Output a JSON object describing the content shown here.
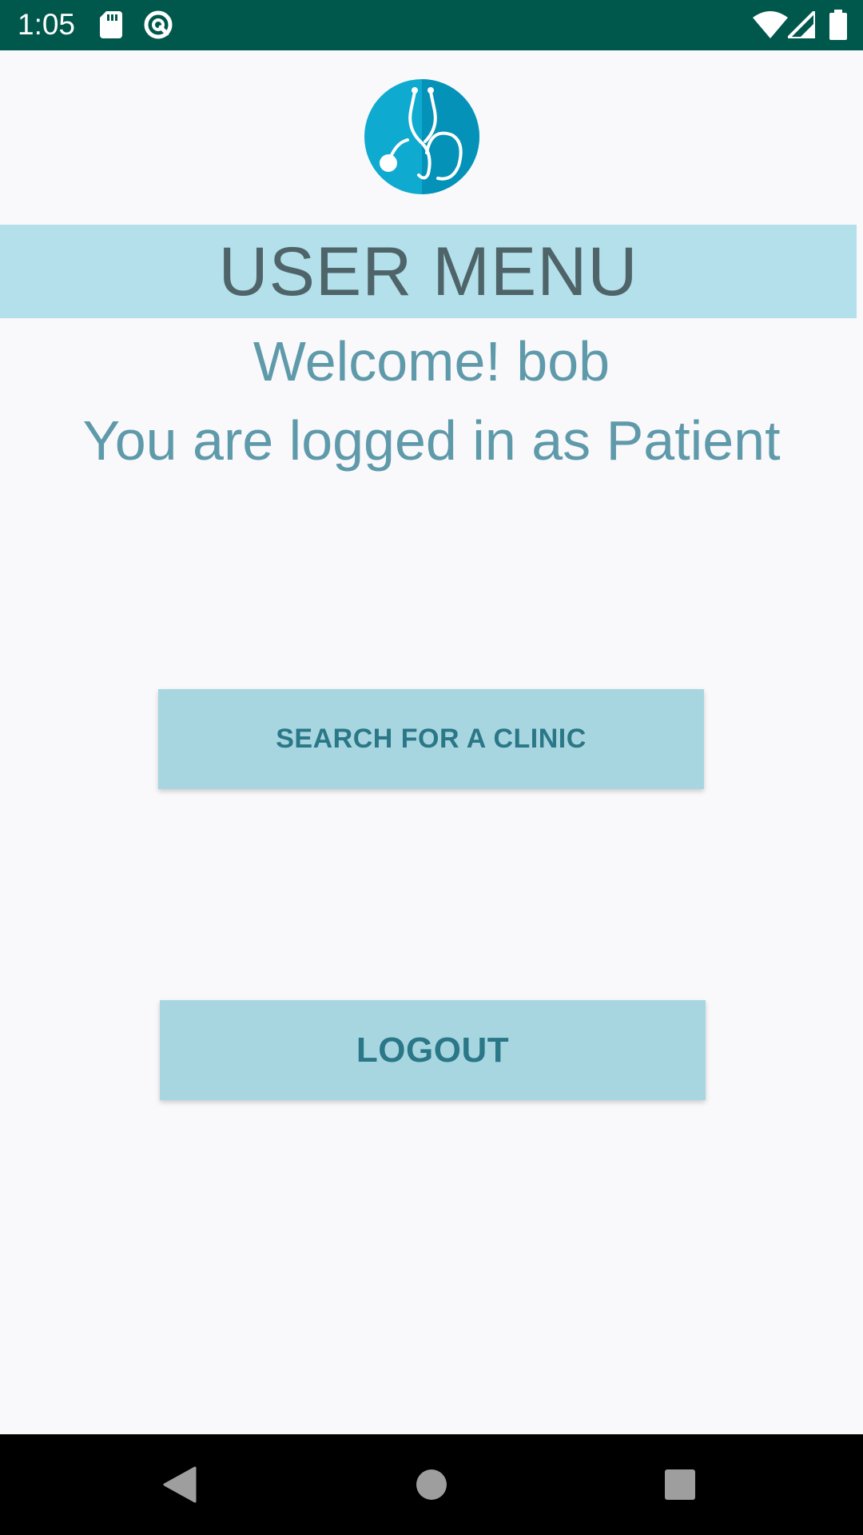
{
  "status_bar": {
    "time": "1:05",
    "background_color": "#00584d",
    "icons": [
      "sd-card-icon",
      "ring-icon",
      "wifi-icon",
      "signal-icon",
      "battery-icon"
    ]
  },
  "logo": {
    "icon": "stethoscope-icon",
    "color": "#0b9cc6"
  },
  "header": {
    "title": "USER MENU",
    "background_color": "#b3e0eb"
  },
  "welcome": {
    "greeting": "Welcome! bob",
    "role_line": "You are logged in as Patient"
  },
  "buttons": {
    "search_label": "SEARCH FOR A CLINIC",
    "logout_label": "LOGOUT",
    "background_color": "#a8d6e0",
    "text_color": "#2a7788"
  },
  "nav_bar": {
    "icons": [
      "back-icon",
      "home-icon",
      "recents-icon"
    ]
  }
}
